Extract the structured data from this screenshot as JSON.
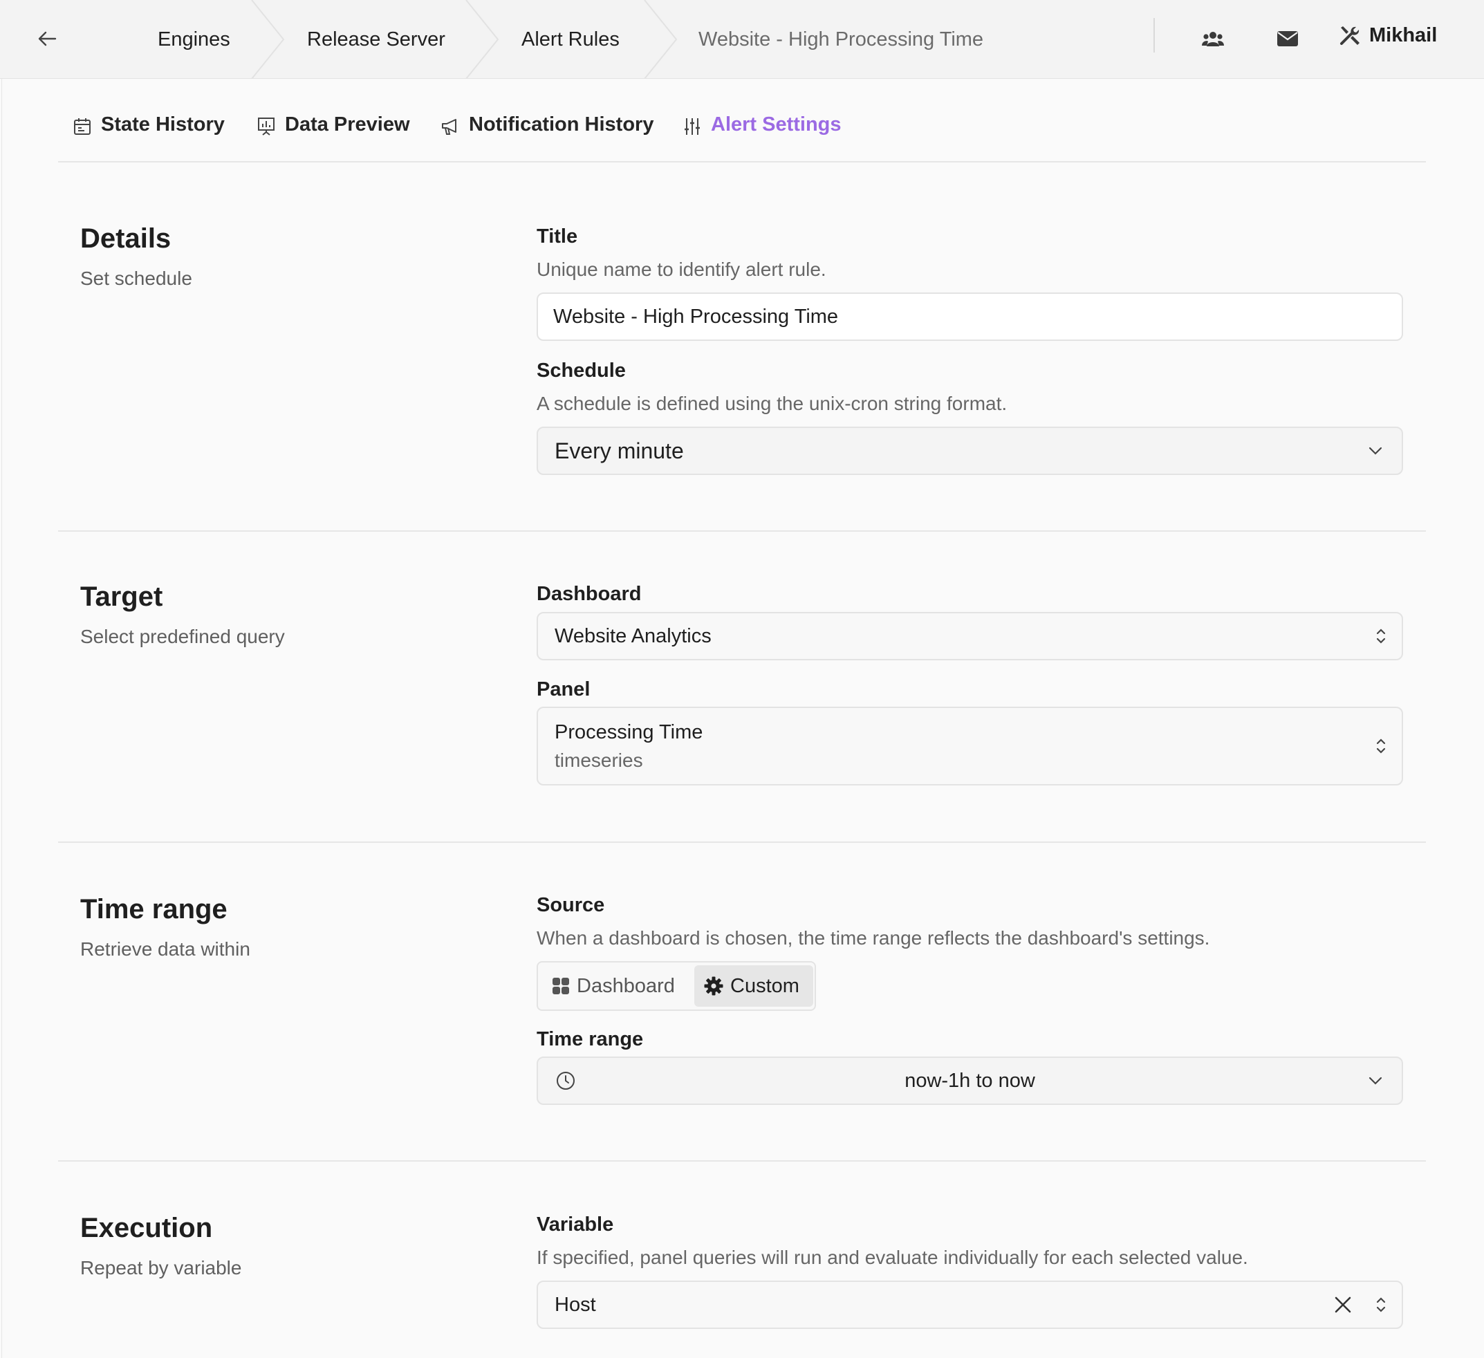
{
  "breadcrumbs": [
    {
      "label": "Engines"
    },
    {
      "label": "Release Server"
    },
    {
      "label": "Alert Rules"
    },
    {
      "label": "Website - High Processing Time"
    }
  ],
  "user": {
    "name": "Mikhail"
  },
  "icons": {
    "back": "arrow-left-icon",
    "team": "users-icon",
    "mail": "envelope-icon",
    "user": "tools-icon"
  },
  "tabs": [
    {
      "label": "State History",
      "icon": "calendar-icon",
      "active": false
    },
    {
      "label": "Data Preview",
      "icon": "presentation-chart-icon",
      "active": false
    },
    {
      "label": "Notification History",
      "icon": "megaphone-icon",
      "active": false
    },
    {
      "label": "Alert Settings",
      "icon": "sliders-icon",
      "active": true
    }
  ],
  "colors": {
    "accent": "#9b6ae3"
  },
  "details": {
    "title": "Details",
    "subtitle": "Set schedule",
    "title_field": {
      "label": "Title",
      "help": "Unique name to identify alert rule.",
      "value": "Website - High Processing Time"
    },
    "schedule_field": {
      "label": "Schedule",
      "help": "A schedule is defined using the unix-cron string format.",
      "value": "Every minute"
    }
  },
  "target": {
    "title": "Target",
    "subtitle": "Select predefined query",
    "dashboard_field": {
      "label": "Dashboard",
      "value": "Website Analytics"
    },
    "panel_field": {
      "label": "Panel",
      "value": "Processing Time",
      "sub": "timeseries"
    }
  },
  "time_range": {
    "title": "Time range",
    "subtitle": "Retrieve data within",
    "source_field": {
      "label": "Source",
      "help": "When a dashboard is chosen, the time range reflects the dashboard's settings.",
      "options": [
        "Dashboard",
        "Custom"
      ],
      "selected": "Custom"
    },
    "range_field": {
      "label": "Time range",
      "value": "now-1h to now"
    }
  },
  "execution": {
    "title": "Execution",
    "subtitle": "Repeat by variable",
    "variable_field": {
      "label": "Variable",
      "help": "If specified, panel queries will run and evaluate individually for each selected value.",
      "value": "Host"
    }
  }
}
